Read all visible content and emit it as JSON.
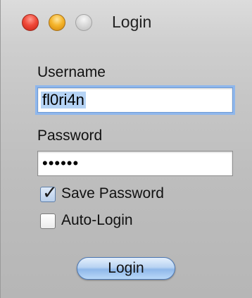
{
  "window": {
    "title": "Login",
    "controls": {
      "close_color": "#f04a3a",
      "minimize_color": "#f5b52c",
      "zoom_color": "#d8d8d8"
    }
  },
  "form": {
    "username_label": "Username",
    "username_value": "fl0ri4n",
    "password_label": "Password",
    "password_display": "••••••",
    "save_password_label": "Save Password",
    "save_password_checked": true,
    "checkmark_glyph": "✓",
    "auto_login_label": "Auto-Login",
    "auto_login_checked": false,
    "login_button_label": "Login"
  },
  "colors": {
    "focus_ring": "#8fb7ec",
    "button_accent": "#8fb8ea"
  }
}
